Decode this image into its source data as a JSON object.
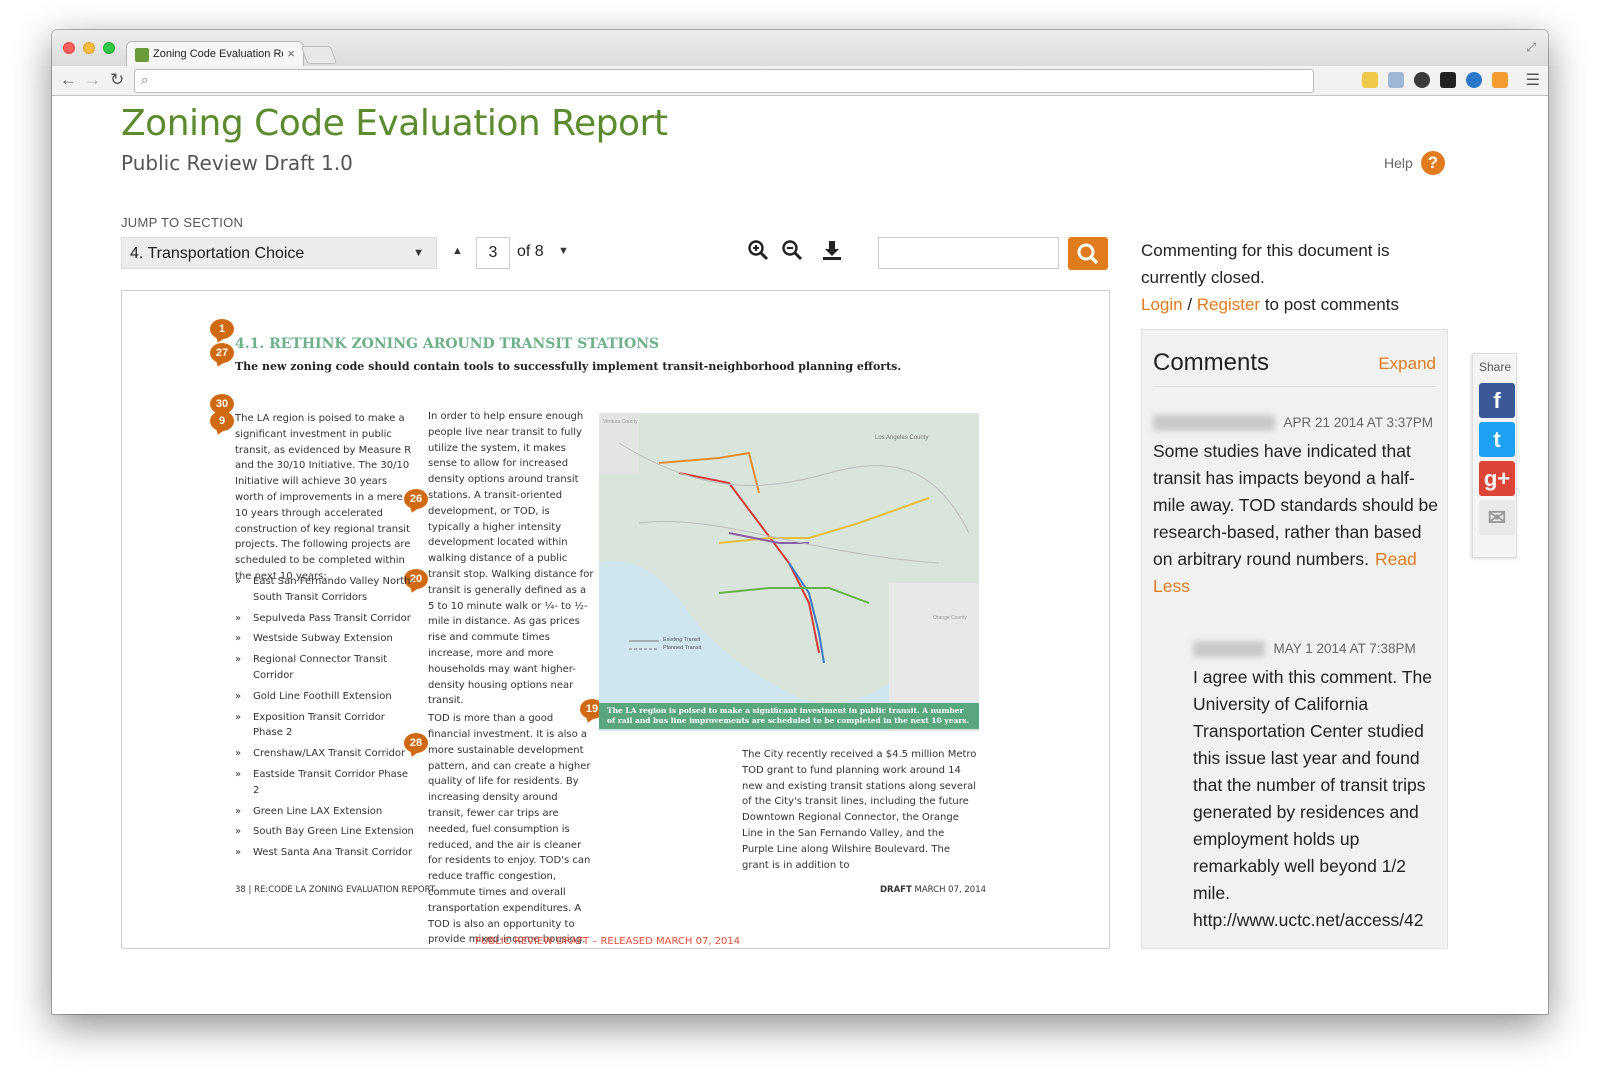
{
  "browser": {
    "tab_title": "Zoning Code Evaluation Re",
    "tab_close": "×",
    "url": ""
  },
  "header": {
    "title": "Zoning Code Evaluation Report",
    "subtitle": "Public Review Draft 1.0",
    "help_label": "Help",
    "help_icon": "?"
  },
  "toolbar": {
    "jump_label": "JUMP TO SECTION",
    "section_value": "4. Transportation Choice",
    "page_current": "3",
    "page_total_label": "of 8",
    "search_placeholder": ""
  },
  "document": {
    "pins": [
      "1",
      "27",
      "30",
      "9",
      "26",
      "20",
      "19",
      "28"
    ],
    "heading": "4.1. RETHINK ZONING AROUND TRANSIT STATIONS",
    "subheading": "The new zoning code should contain tools to successfully implement transit-neighborhood planning efforts.",
    "col1_text": "The LA region is poised to make a significant investment in public transit, as evidenced by Measure R and the 30/10 Initiative. The 30/10 Initiative will achieve 30 years worth of improvements in a mere 10 years through accelerated construction of key regional transit projects. The following projects are scheduled to be completed within the next 10 years:",
    "bullets": [
      "East San Fernando Valley North-South Transit Corridors",
      "Sepulveda Pass Transit Corridor",
      "Westside Subway Extension",
      "Regional Connector Transit Corridor",
      "Gold Line Foothill Extension",
      "Exposition Transit Corridor Phase 2",
      "Crenshaw/LAX Transit Corridor",
      "Eastside Transit Corridor Phase 2",
      "Green Line LAX Extension",
      "South Bay Green Line Extension",
      "West Santa Ana Transit Corridor"
    ],
    "col2_text": "In order to help ensure enough people live near transit to fully utilize the system, it makes sense to allow for increased density options around transit stations. A transit-oriented development, or TOD, is typically a higher intensity development located within walking distance of a public transit stop. Walking distance for transit is generally defined as a 5 to 10 minute walk or ¼- to ½-mile in distance. As gas prices rise and commute times increase, more and more households may want higher-density housing options near transit.",
    "col2b_text": "TOD is more than a good financial investment. It is also a more sustainable development pattern, and can create a higher quality of life for residents. By increasing density around transit, fewer car trips are needed, fuel consumption is reduced, and the air is cleaner for residents to enjoy. TOD's can reduce traffic congestion, commute times and overall transportation expenditures. A TOD is also an opportunity to provide mixed-income housing. Affordable housing, parks and other public benefits can be funded through density incentives for new construction.",
    "col3_text": "The City recently received a $4.5 million Metro TOD grant to fund planning work around 14 new and existing transit stations along several of the City's transit lines, including the future Downtown Regional Connector, the Orange Line in the San Fernando Valley, and the Purple Line along Wilshire Boulevard. The grant is in addition to",
    "map_caption": "The LA region is poised to make a significant investment in public transit. A number of rail and bus line improvements are scheduled to be completed in the next 10 years.",
    "map_labels": {
      "county": "Los Angeles County",
      "existing": "Existing Transit",
      "planned": "Planned Transit",
      "ventura": "Ventura County",
      "orange": "Orange County"
    },
    "footer_left": "38  |  RE:CODE LA ZONING EVALUATION REPORT",
    "footer_right_bold": "DRAFT",
    "footer_right": "MARCH 07, 2014",
    "draft_banner": "PUBLIC REVIEW DRAFT – RELEASED MARCH 07, 2014"
  },
  "sidebar": {
    "closed_note": "Commenting for this document is currently closed.",
    "login": "Login",
    "sep": " / ",
    "register": "Register",
    "post_suffix": " to post comments",
    "comments_title": "Comments",
    "expand": "Expand",
    "comments": [
      {
        "author": "josephusmyer",
        "date": "APR 21 2014 AT 3:37PM",
        "body": "Some studies have indicated that transit has impacts beyond a half-mile away. TOD standards should be research-based, rather than based on arbitrary round numbers.",
        "read_less": "Read Less"
      },
      {
        "author": "letagoia",
        "date": "MAY 1 2014 AT 7:38PM",
        "body": "I agree with this comment. The University of California Transportation Center studied this issue last year and found that the number of transit trips generated by residences and employment holds up remarkably well beyond 1/2 mile. http://www.uctc.net/access/42"
      }
    ]
  },
  "share": {
    "label": "Share",
    "facebook": "f",
    "twitter": "t",
    "googleplus": "g+",
    "email": "✉"
  },
  "colors": {
    "brand_green": "#5c8a2e",
    "accent_orange": "#e07b1e",
    "pin_orange": "#d06a12",
    "heading_teal": "#6db08a"
  }
}
